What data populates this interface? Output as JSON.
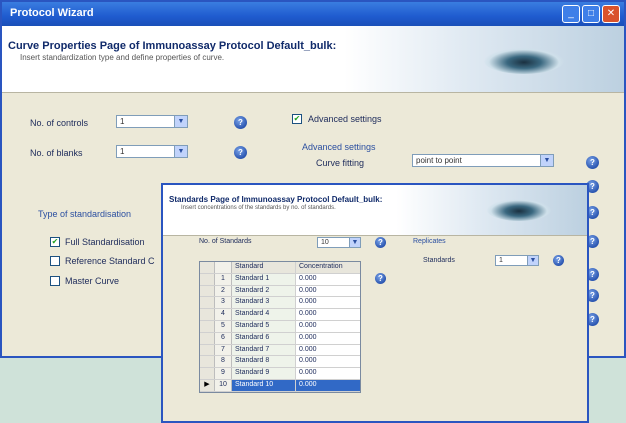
{
  "main_window": {
    "title": "Protocol Wizard",
    "header_title": "Curve Properties Page of Immunoassay Protocol Default_bulk:",
    "header_subtitle": "Insert standardization type and define properties of curve.",
    "controls_label": "No. of controls",
    "controls_value": "1",
    "blanks_label": "No. of blanks",
    "blanks_value": "1",
    "advanced_checkbox_label": "Advanced settings",
    "advanced_section": "Advanced settings",
    "curve_fitting_label": "Curve fitting",
    "curve_fitting_value": "point to point",
    "type_of_standardisation": "Type of standardisation",
    "options": [
      "Full Standardisation",
      "Reference Standard C",
      "Master Curve"
    ],
    "selected_option": 0
  },
  "sub_window": {
    "header_title": "Standards Page of Immunoassay Protocol Default_bulk:",
    "header_subtitle": "Insert concentrations of the standards by no. of standards.",
    "standards_label": "No. of Standards",
    "standards_value": "10",
    "replicates_section": "Replicates",
    "replicates_label": "Standards",
    "replicates_value": "1",
    "grid_headers": [
      "",
      "",
      "Standard",
      "Concentration"
    ],
    "rows": [
      {
        "n": "1",
        "name": "Standard 1",
        "conc": "0.000"
      },
      {
        "n": "2",
        "name": "Standard 2",
        "conc": "0.000"
      },
      {
        "n": "3",
        "name": "Standard 3",
        "conc": "0.000"
      },
      {
        "n": "4",
        "name": "Standard 4",
        "conc": "0.000"
      },
      {
        "n": "5",
        "name": "Standard 5",
        "conc": "0.000"
      },
      {
        "n": "6",
        "name": "Standard 6",
        "conc": "0.000"
      },
      {
        "n": "7",
        "name": "Standard 7",
        "conc": "0.000"
      },
      {
        "n": "8",
        "name": "Standard 8",
        "conc": "0.000"
      },
      {
        "n": "9",
        "name": "Standard 9",
        "conc": "0.000"
      },
      {
        "n": "10",
        "name": "Standard 10",
        "conc": "0.000"
      }
    ],
    "selected_row": 9
  }
}
